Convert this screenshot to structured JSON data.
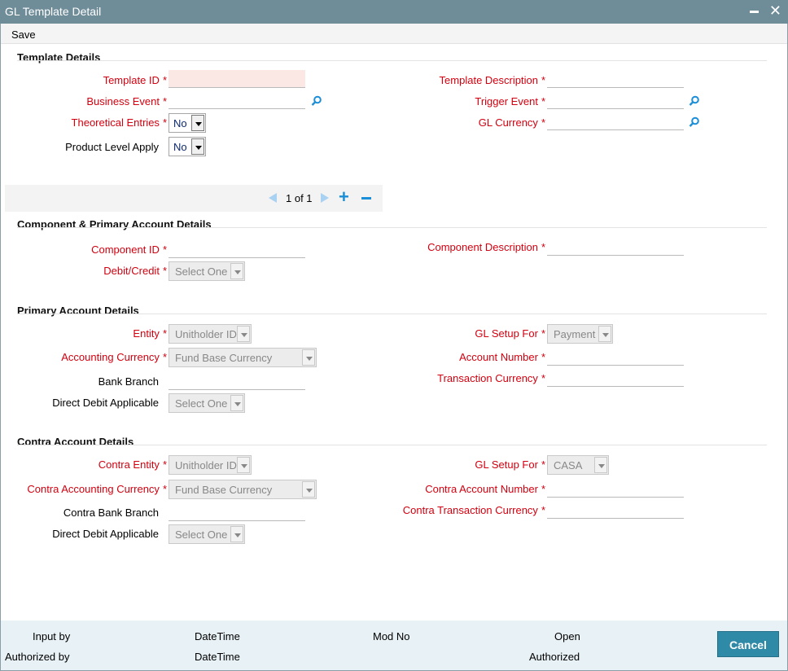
{
  "window": {
    "title": "GL Template Detail"
  },
  "toolbar": {
    "save_label": "Save"
  },
  "template_details": {
    "section_title": "Template Details",
    "template_id": {
      "label": "Template ID",
      "value": ""
    },
    "template_description": {
      "label": "Template Description",
      "value": ""
    },
    "business_event": {
      "label": "Business Event",
      "value": ""
    },
    "trigger_event": {
      "label": "Trigger Event",
      "value": ""
    },
    "theoretical_entries": {
      "label": "Theoretical Entries",
      "value": "No"
    },
    "gl_currency": {
      "label": "GL Currency",
      "value": ""
    },
    "product_level_apply": {
      "label": "Product Level Apply",
      "value": "No"
    }
  },
  "pager": {
    "text": "1 of 1"
  },
  "component_details": {
    "section_title": "Component & Primary Account Details",
    "component_id": {
      "label": "Component ID",
      "value": ""
    },
    "component_description": {
      "label": "Component Description",
      "value": ""
    },
    "debit_credit": {
      "label": "Debit/Credit",
      "value": "Select One"
    }
  },
  "primary_account": {
    "section_title": "Primary Account Details",
    "entity": {
      "label": "Entity",
      "value": "Unitholder ID"
    },
    "gl_setup_for": {
      "label": "GL Setup For",
      "value": "Payment"
    },
    "accounting_currency": {
      "label": "Accounting Currency",
      "value": "Fund Base Currency"
    },
    "account_number": {
      "label": "Account Number",
      "value": ""
    },
    "bank_branch": {
      "label": "Bank Branch",
      "value": ""
    },
    "transaction_currency": {
      "label": "Transaction Currency",
      "value": ""
    },
    "direct_debit": {
      "label": "Direct Debit Applicable",
      "value": "Select One"
    }
  },
  "contra_account": {
    "section_title": "Contra Account Details",
    "entity": {
      "label": "Contra Entity",
      "value": "Unitholder ID"
    },
    "gl_setup_for": {
      "label": "GL Setup For",
      "value": "CASA"
    },
    "accounting_currency": {
      "label": "Contra Accounting Currency",
      "value": "Fund Base Currency"
    },
    "account_number": {
      "label": "Contra Account Number",
      "value": ""
    },
    "bank_branch": {
      "label": "Contra Bank Branch",
      "value": ""
    },
    "transaction_currency": {
      "label": "Contra Transaction Currency",
      "value": ""
    },
    "direct_debit": {
      "label": "Direct Debit Applicable",
      "value": "Select One"
    }
  },
  "footer": {
    "input_by": "Input by",
    "authorized_by": "Authorized by",
    "datetime_1": "DateTime",
    "datetime_2": "DateTime",
    "mod_no": "Mod No",
    "open": "Open",
    "authorized": "Authorized",
    "cancel_label": "Cancel"
  },
  "required_marker": "*",
  "colors": {
    "titlebar": "#6f8c99",
    "required": "#d3000f",
    "accent": "#1a8ed6",
    "cancel": "#2f8aa8"
  }
}
